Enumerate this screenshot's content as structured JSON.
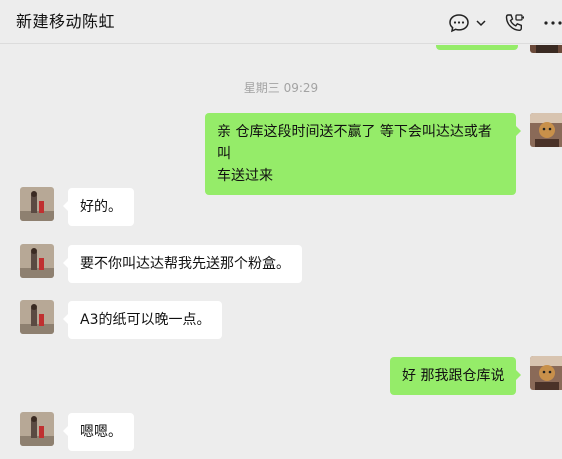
{
  "header": {
    "title": "新建移动陈虹",
    "icons": [
      "chat-bubble-icon",
      "chevron-down-icon",
      "video-call-icon",
      "more-icon"
    ]
  },
  "chat": {
    "timestamp": "星期三 09:29",
    "messages": [
      {
        "sender": "self",
        "text_line1": "亲 仓库这段时间送不赢了 等下会叫达达或者叫",
        "text_line2": "车送过来"
      },
      {
        "sender": "contact",
        "text": "好的。"
      },
      {
        "sender": "contact",
        "text": "要不你叫达达帮我先送那个粉盒。"
      },
      {
        "sender": "contact",
        "text": "A3的纸可以晚一点。"
      },
      {
        "sender": "self",
        "text": "好 那我跟仓库说"
      },
      {
        "sender": "contact",
        "text": "嗯嗯。"
      }
    ]
  },
  "colors": {
    "background": "#ededed",
    "incoming_bubble": "#ffffff",
    "outgoing_bubble": "#95ec69",
    "timestamp": "#a3a3a3"
  }
}
